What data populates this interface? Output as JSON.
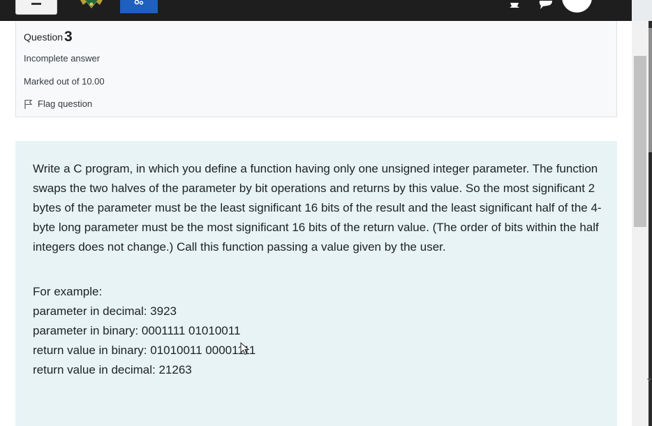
{
  "question": {
    "label": "Question",
    "number": "3",
    "state": "Incomplete answer",
    "grade": "Marked out of 10.00",
    "flag_label": "Flag question"
  },
  "question_text": {
    "paragraph": "Write a C program, in which you define a function having only one unsigned integer parameter. The function swaps the two halves of the parameter by bit operations and returns by this value. So the most significant 2 bytes of the parameter must be the least significant 16 bits of the result and the least significant half of the 4-byte long parameter must be the most significant 16 bits of the return value. (The order of bits within the half integers does not change.) Call this function passing a value given by the user.",
    "example_lines": [
      "For example:",
      "parameter in decimal: 3923",
      "parameter in binary: 0001111 01010011",
      "return value in binary: 01010011 00001111",
      "return value in decimal: 21263"
    ]
  },
  "colors": {
    "navbar": "#1e1e1e",
    "accent": "#1f5fbd",
    "question_background": "#e7f3f5"
  },
  "icons": {
    "menu": "hamburger-icon",
    "logo": "site-logo-icon",
    "settings": "gear-icon",
    "notifications": "bell-icon",
    "messages": "chat-icon",
    "user": "avatar",
    "flag": "flag-icon"
  }
}
